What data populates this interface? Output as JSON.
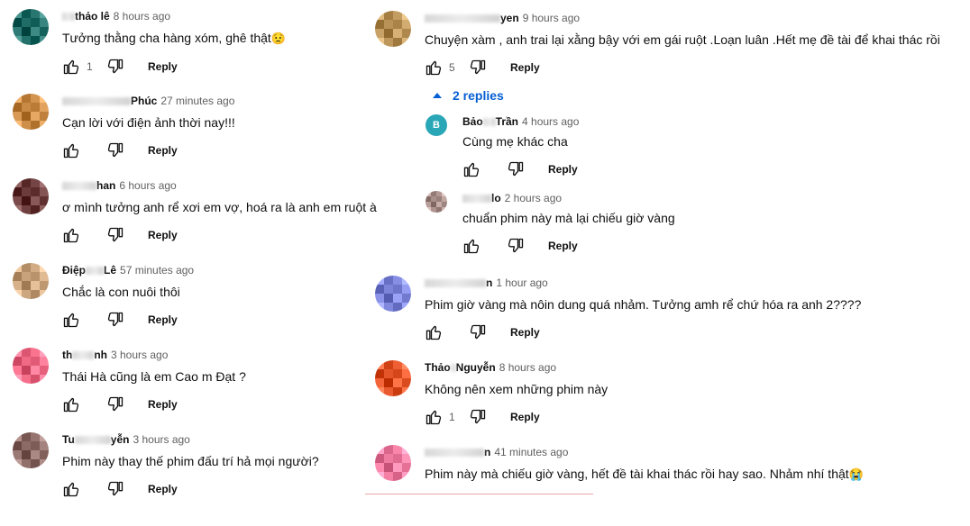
{
  "comments_left": [
    {
      "author_start": "",
      "author_end": "thảo lê",
      "time": "8 hours ago",
      "text": "Tưởng thằng cha hàng xóm, ghê thật",
      "emoji": "😟",
      "likes": "1",
      "reply_label": "Reply"
    },
    {
      "author_start": "",
      "author_end": "Phúc",
      "time": "27 minutes ago",
      "text": "Cạn lời với điện ảnh thời nay!!!",
      "emoji": "",
      "likes": "",
      "reply_label": "Reply"
    },
    {
      "author_start": "",
      "author_end": "han",
      "time": "6 hours ago",
      "text": "ơ mình tưởng anh rể xơi em vợ, hoá ra là anh em ruột à",
      "emoji": "",
      "likes": "",
      "reply_label": "Reply"
    },
    {
      "author_start": "Điệp",
      "author_end": "Lê",
      "time": "57 minutes ago",
      "text": "Chắc là con nuôi thôi",
      "emoji": "",
      "likes": "",
      "reply_label": "Reply"
    },
    {
      "author_start": "th",
      "author_end": "nh",
      "time": "3 hours ago",
      "text": "Thái Hà cũng là em Cao m Đạt ?",
      "emoji": "",
      "likes": "",
      "reply_label": "Reply"
    },
    {
      "author_start": "Tu",
      "author_end": "yễn",
      "time": "3 hours ago",
      "text": "Phim này thay thế phim đấu trí hả mọi người?",
      "emoji": "",
      "likes": "",
      "reply_label": "Reply"
    }
  ],
  "comments_right": [
    {
      "author_start": "",
      "author_end": "yen",
      "time": "9 hours ago",
      "text": "Chuyện xàm , anh trai lại xằng bậy với em gái ruột .Loạn luân .Hết mẹ đề tài để khai thác rồi",
      "emoji": "",
      "likes": "5",
      "reply_label": "Reply"
    },
    {
      "author_start": "",
      "author_end": "n",
      "time": "1 hour ago",
      "text": "Phim giờ vàng mà nôin dung quá nhảm. Tưởng amh rể chứ hóa ra anh 2????",
      "emoji": "",
      "likes": "",
      "reply_label": "Reply"
    },
    {
      "author_start": "Thảo",
      "author_end": "Nguyễn",
      "time": "8 hours ago",
      "text": "Không nên xem những phim này",
      "emoji": "",
      "likes": "1",
      "reply_label": "Reply"
    },
    {
      "author_start": "",
      "author_end": "n",
      "time": "41 minutes ago",
      "text": "Phim này mà chiếu giờ vàng, hết đề tài khai thác rồi hay sao. Nhảm nhí thật",
      "emoji": "😭",
      "likes": "",
      "reply_label": "Reply"
    }
  ],
  "replies_toggle": "2 replies",
  "replies": [
    {
      "avatar_letter": "B",
      "author_start": "Bảo",
      "author_end": "Trần",
      "time": "4 hours ago",
      "text": "Cùng mẹ khác cha",
      "likes": "",
      "reply_label": "Reply"
    },
    {
      "avatar_letter": "",
      "author_start": "",
      "author_end": "lo",
      "time": "2 hours ago",
      "text": "chuẩn phim này mà lại chiếu giờ vàng",
      "likes": "",
      "reply_label": "Reply"
    }
  ],
  "colors": {
    "link": "#065fd4",
    "meta": "#606060",
    "text": "#0f0f0f",
    "avatars_left": [
      "#1f6b66",
      "#c98a45",
      "#6b3b3b",
      "#c7a27a",
      "#f06a86",
      "#8c6a66"
    ],
    "avatars_right": [
      "#b89256",
      "#7b84d8",
      "#e4552a",
      "#f07ba0"
    ],
    "reply_avatars": [
      "#2aa7b7",
      "#a88f8a"
    ]
  },
  "icons": [
    "like-icon",
    "dislike-icon",
    "caret-up-icon"
  ]
}
